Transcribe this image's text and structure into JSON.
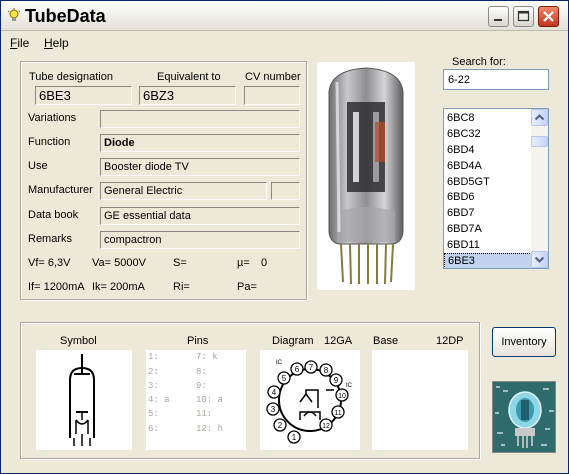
{
  "window": {
    "title": "TubeData"
  },
  "menu": {
    "file": "File",
    "help": "Help"
  },
  "tube": {
    "designation_label": "Tube designation",
    "designation_value": "6BE3",
    "equivalent_label": "Equivalent to",
    "equivalent_value": "6BZ3",
    "cv_label": "CV number",
    "cv_value": "",
    "variations_label": "Variations",
    "variations_value": "",
    "function_label": "Function",
    "function_value": "Diode",
    "use_label": "Use",
    "use_value": "Booster diode TV",
    "manufacturer_label": "Manufacturer",
    "manufacturer_value": "General Electric",
    "manufacturer_code": "",
    "databook_label": "Data book",
    "databook_value": "GE essential data",
    "remarks_label": "Remarks",
    "remarks_value": "compactron",
    "params": {
      "vf": "Vf= 6,3V",
      "va": "Va= 5000V",
      "s": "S=",
      "mu": "µ=",
      "mu_value": "0",
      "if": "If= 1200mA",
      "ik": "Ik=  200mA",
      "ri": "Ri=",
      "pa": "Pa="
    }
  },
  "search": {
    "label": "Search for:",
    "value": "6-22"
  },
  "tube_list": {
    "items": [
      "6BC8",
      "6BC32",
      "6BD4",
      "6BD4A",
      "6BD5GT",
      "6BD6",
      "6BD7",
      "6BD7A",
      "6BD11",
      "6BE3"
    ],
    "selected": "6BE3"
  },
  "bottom": {
    "symbol_label": "Symbol",
    "pins_label": "Pins",
    "diagram_label": "Diagram",
    "diagram_code": "12GA",
    "base_label": "Base",
    "base_code": "12DP",
    "pins": {
      "p1": "1:",
      "p2": "2:",
      "p3": "3:",
      "p4": "4: a",
      "p5": "5:",
      "p6": "6:",
      "p7": "7: k",
      "p8": "8:",
      "p9": "9:",
      "p10": "10: a",
      "p11": "11:",
      "p12": "12: h"
    },
    "diagram_pins": [
      "1",
      "2",
      "3",
      "4",
      "5",
      "6",
      "7",
      "8",
      "9",
      "10",
      "11",
      "12"
    ],
    "diagram_ic": "IC"
  },
  "inventory_button": "Inventory",
  "icons": {
    "app": "lightbulb-icon",
    "minimize": "minimize-icon",
    "maximize": "maximize-icon",
    "close": "close-icon"
  },
  "colors": {
    "close_button": "#c2351a",
    "selection": "#c1d2ee",
    "logo_bg": "#2e6b6a"
  }
}
